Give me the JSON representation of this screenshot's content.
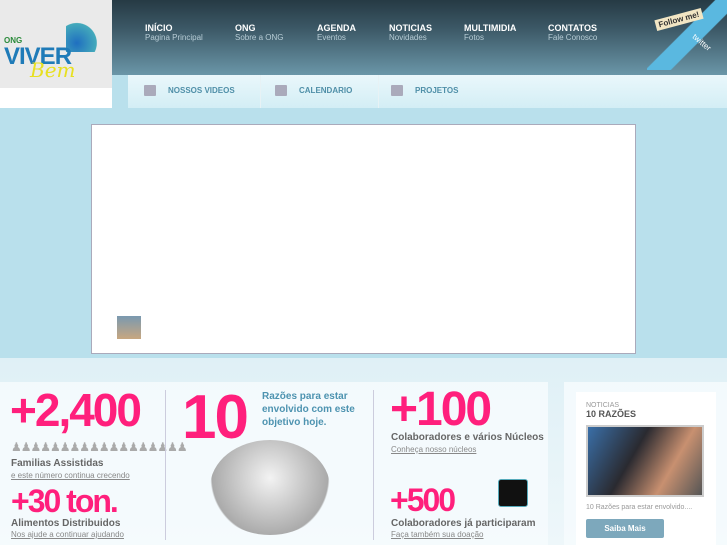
{
  "logo": {
    "ong": "ONG",
    "viver": "VIVER",
    "bem": "Bem"
  },
  "nav": [
    {
      "label": "INÍCIO",
      "sub": "Pagina Principal"
    },
    {
      "label": "ONG",
      "sub": "Sobre a ONG"
    },
    {
      "label": "AGENDA",
      "sub": "Eventos"
    },
    {
      "label": "NOTICIAS",
      "sub": "Novidades"
    },
    {
      "label": "MULTIMIDIA",
      "sub": "Fotos"
    },
    {
      "label": "CONTATOS",
      "sub": "Fale Conosco"
    }
  ],
  "twitter": {
    "follow": "Follow me!",
    "brand": "twitter"
  },
  "subnav": [
    "NOSSOS VIDEOS",
    "CALENDARIO",
    "PROJETOS"
  ],
  "stats": {
    "families": {
      "value": "+2,400",
      "label": "Familias Assistidas",
      "link": "e este número continua crecendo"
    },
    "food": {
      "value": "+30 ton.",
      "label": "Alimentos Distribuidos",
      "link": "Nos ajude a continuar ajudando"
    },
    "reasons": {
      "value": "10",
      "text": "Razões para estar envolvido com este objetivo hoje."
    },
    "collab": {
      "value": "+100",
      "label": "Colaboradores e vários Núcleos",
      "link": "Conheça nosso núcleos"
    },
    "participants": {
      "value": "+500",
      "label": "Colaboradores já participaram",
      "link": "Faça também sua doação"
    }
  },
  "news": {
    "category": "NOTICIAS",
    "title": "10 RAZÕES",
    "caption": "10 Razões para estar envolvido....",
    "button": "Saiba Mais"
  }
}
